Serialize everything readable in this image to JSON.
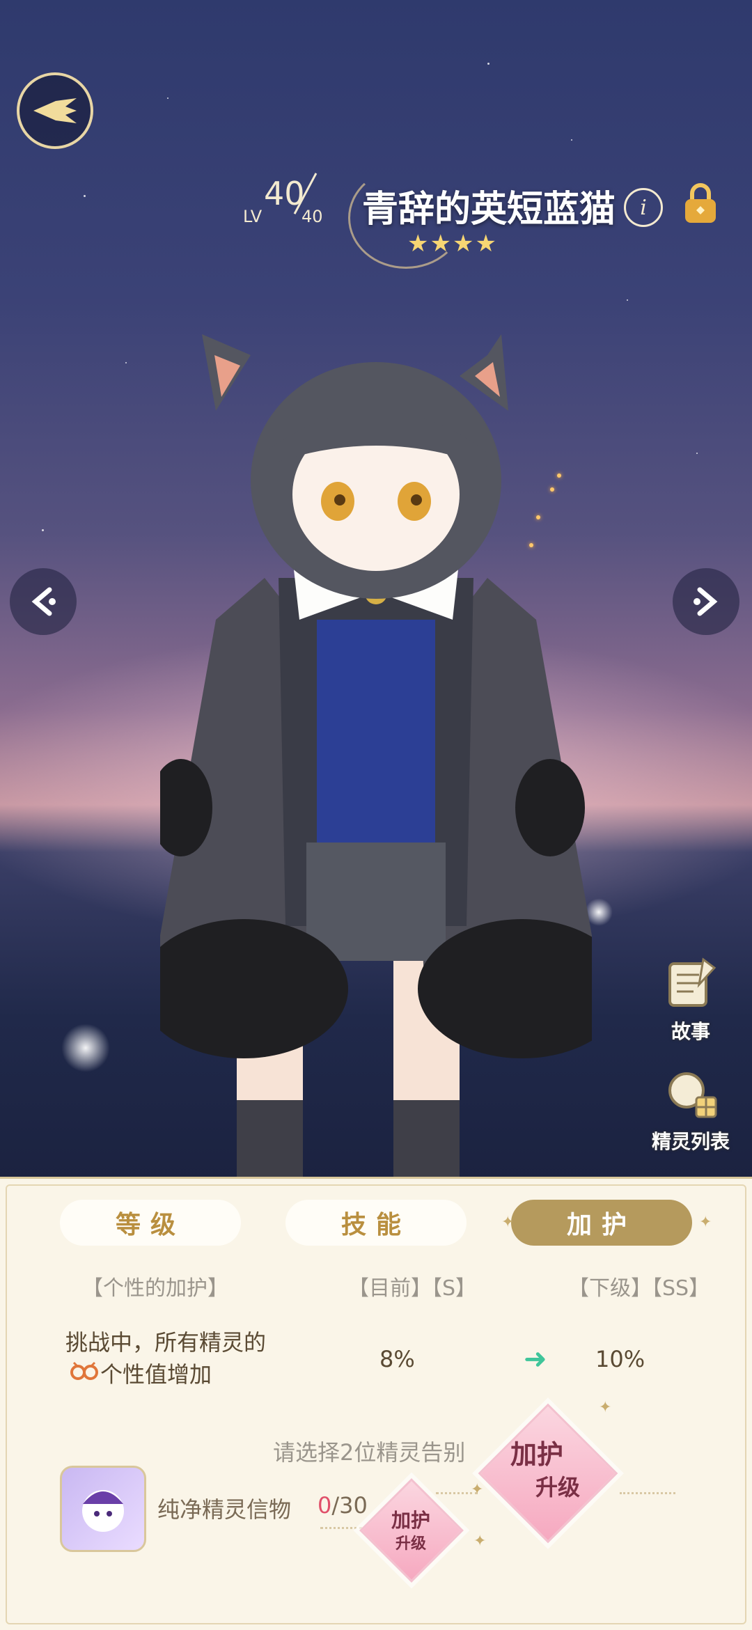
{
  "pet": {
    "level_label": "LV",
    "level_current": "40",
    "level_max": "40",
    "name": "青辞的英短蓝猫",
    "star_rating": "★★★★",
    "info_icon": "i"
  },
  "side_buttons": {
    "story_label": "故事",
    "spirit_list_label": "精灵列表"
  },
  "tabs": {
    "level": "等级",
    "skill": "技能",
    "protect": "加护"
  },
  "protection": {
    "header_name": "【个性的加护】",
    "header_current": "【目前】【S】",
    "header_next": "【下级】【SS】",
    "desc_line1": "挑战中，所有精灵的",
    "desc_line2": "个性值增加",
    "current_value": "8%",
    "next_value": "10%",
    "arrow": "➜"
  },
  "upgrade": {
    "prompt": "请选择2位精灵告别",
    "item_name": "纯净精灵信物",
    "item_count_current": "0",
    "item_count_sep_total": "/30",
    "small_btn_line1": "加护",
    "small_btn_line2": "升级",
    "big_btn_line1": "加护",
    "big_btn_line2": "升级"
  },
  "colors": {
    "tab_active": "#b59a5d",
    "tab_text": "#b98f3f",
    "arrow_green": "#3fc59a",
    "count_red": "#e0506a"
  }
}
